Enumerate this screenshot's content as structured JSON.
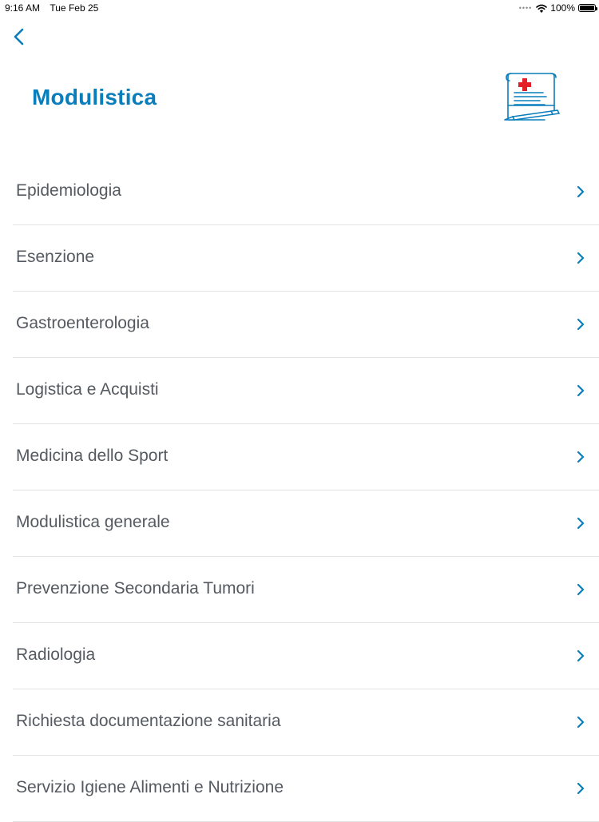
{
  "status_bar": {
    "time": "9:16 AM",
    "date": "Tue Feb 25",
    "battery": "100%",
    "icons": [
      "signal-dots-icon",
      "wifi-icon",
      "battery-icon"
    ]
  },
  "header": {
    "back_icon": "chevron-left-icon",
    "title": "Modulistica",
    "illustration": "medical-document-icon"
  },
  "colors": {
    "accent": "#0a7dbb",
    "text": "#555a60",
    "divider": "#e3e3e3",
    "medical_cross": "#e41e26"
  },
  "list": {
    "chevron_icon": "chevron-right-icon",
    "items": [
      {
        "label": "Epidemiologia"
      },
      {
        "label": "Esenzione"
      },
      {
        "label": "Gastroenterologia"
      },
      {
        "label": "Logistica e Acquisti"
      },
      {
        "label": "Medicina dello Sport"
      },
      {
        "label": "Modulistica generale"
      },
      {
        "label": "Prevenzione Secondaria Tumori"
      },
      {
        "label": "Radiologia"
      },
      {
        "label": "Richiesta documentazione sanitaria"
      },
      {
        "label": "Servizio Igiene Alimenti e Nutrizione"
      }
    ]
  }
}
